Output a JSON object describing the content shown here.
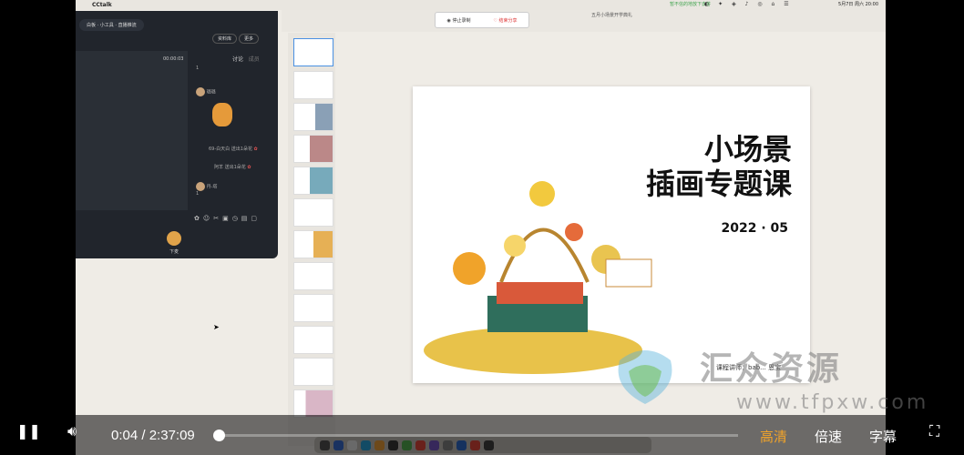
{
  "menubar": {
    "app": "CCtalk",
    "notice": "暂不信的地放下去答",
    "clock": "5月7日 周六 20:00"
  },
  "cctalk": {
    "whiteboard": "白板",
    "tools": "小工具",
    "live": "直播推流",
    "files": "资料库",
    "more": "更多",
    "timer": "00:00:03",
    "tab_discuss": "讨论",
    "tab_members": "成员",
    "chat": [
      {
        "name": "",
        "text": "1"
      },
      {
        "name": "璐璐",
        "text": ""
      },
      {
        "name": "",
        "text": "69-白天白 送出1朵花"
      },
      {
        "name": "",
        "text": "阿羊 送出1朵花"
      },
      {
        "name": "丹-塔",
        "text": "1"
      }
    ],
    "hand_label": "下麦"
  },
  "recbar": {
    "stop": "停止录制",
    "end": "结束分享"
  },
  "doc_title": "五月小场景开学典礼",
  "slide": {
    "title_line1": "小场景",
    "title_line2": "插画专题课",
    "date": "2022 · 05",
    "credit": "课程讲师：bab... 恩宝"
  },
  "watermark": {
    "text": "汇众资源",
    "url": "www.tfpxw.com"
  },
  "player": {
    "time_current": "0:04",
    "time_sep": "/",
    "time_total": "2:37:09",
    "quality": "高清",
    "speed": "倍速",
    "subtitles": "字幕",
    "progress": 0.0004
  },
  "colors": {
    "accent": "#f0a32a",
    "player_bg": "#000000"
  }
}
